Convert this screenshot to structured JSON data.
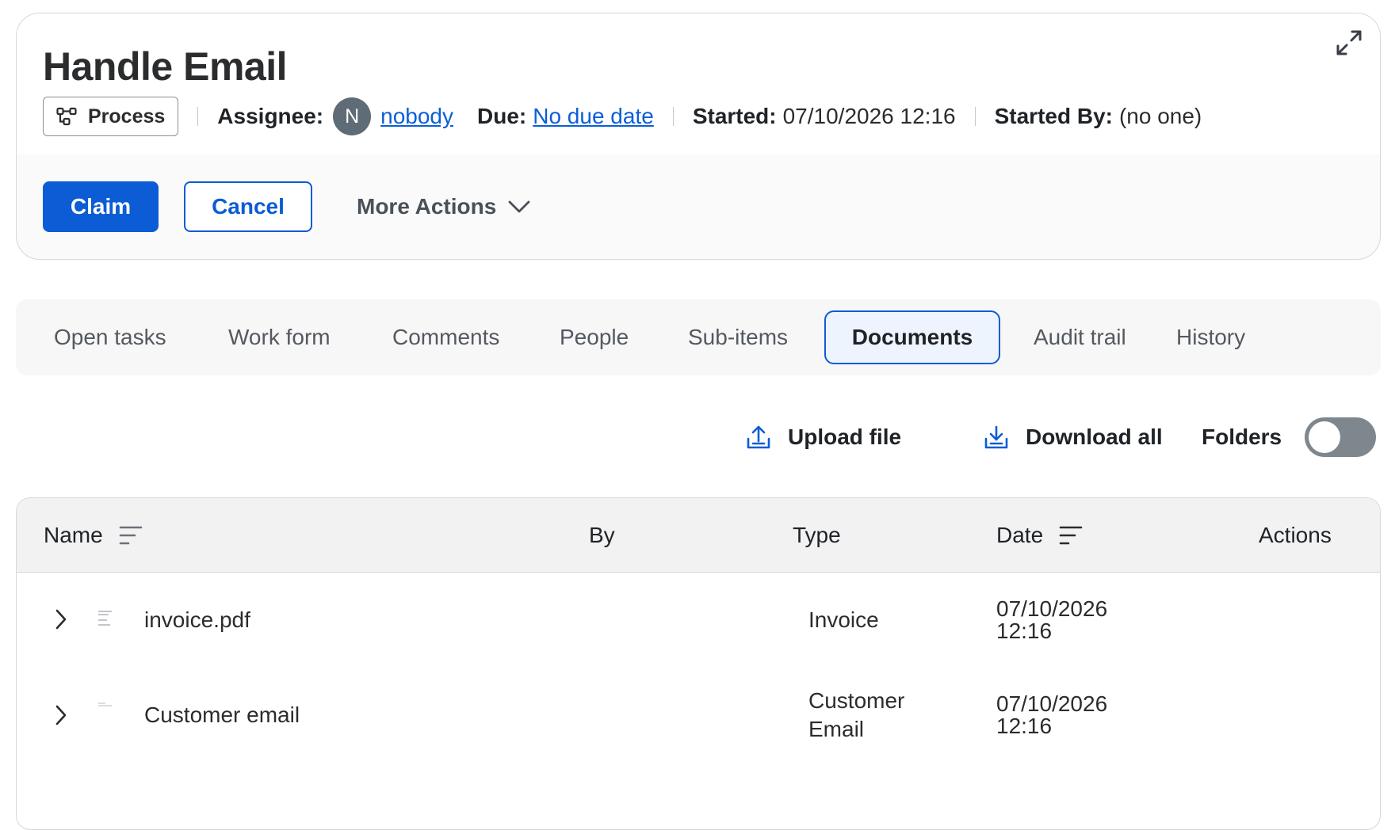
{
  "header": {
    "title": "Handle Email",
    "process_label": "Process",
    "assignee_label": "Assignee:",
    "assignee_initial": "N",
    "assignee_name": "nobody",
    "due_label": "Due:",
    "due_value": "No due date",
    "started_label": "Started:",
    "started_value": "07/10/2026 12:16",
    "started_by_label": "Started By:",
    "started_by_value": "(no one)"
  },
  "actions": {
    "claim": "Claim",
    "cancel": "Cancel",
    "more": "More Actions"
  },
  "tabs": [
    {
      "label": "Open tasks"
    },
    {
      "label": "Work form"
    },
    {
      "label": "Comments"
    },
    {
      "label": "People"
    },
    {
      "label": "Sub-items"
    },
    {
      "label": "Documents",
      "active": true
    },
    {
      "label": "Audit trail"
    },
    {
      "label": "History"
    }
  ],
  "toolbar": {
    "upload": "Upload file",
    "download": "Download all",
    "folders": "Folders",
    "folders_on": false
  },
  "table": {
    "columns": [
      "Name",
      "By",
      "Type",
      "Date",
      "Actions"
    ],
    "rows": [
      {
        "name": "invoice.pdf",
        "by": "",
        "type_line1": "Invoice",
        "type_line2": "",
        "date_line1": "07/10/2026",
        "date_line2": "12:16"
      },
      {
        "name": "Customer email",
        "by": "",
        "type_line1": "Customer",
        "type_line2": "Email",
        "date_line1": "07/10/2026",
        "date_line2": "12:16"
      }
    ]
  },
  "colors": {
    "primary": "#0b5cd5",
    "link": "#0b5ed7",
    "avatar": "#5f6b76",
    "toggle_off": "#7e878d"
  }
}
